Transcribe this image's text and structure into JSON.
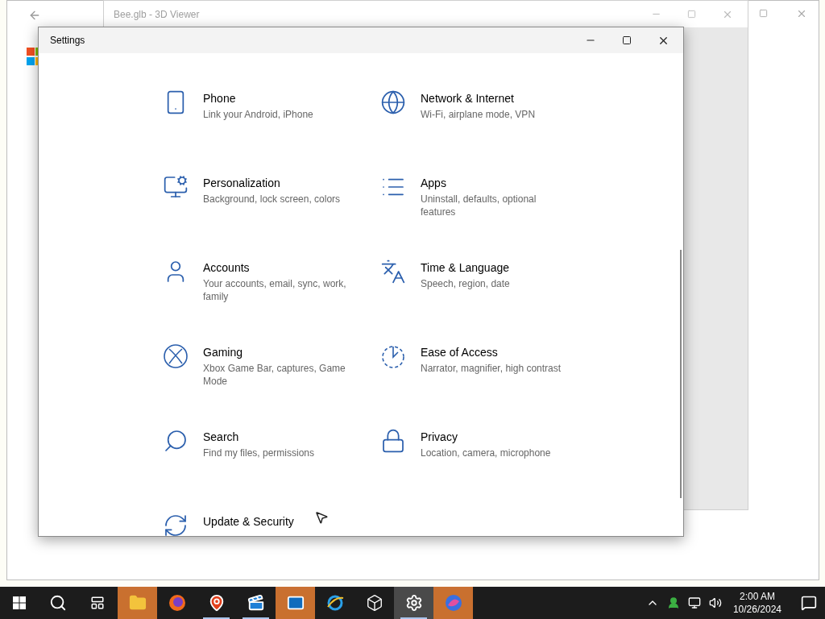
{
  "viewer_window": {
    "title": "Bee.glb - 3D Viewer"
  },
  "settings_window": {
    "title": "Settings",
    "items": [
      {
        "kind": "phone",
        "title": "Phone",
        "subtitle": "Link your Android, iPhone"
      },
      {
        "kind": "network",
        "title": "Network & Internet",
        "subtitle": "Wi-Fi, airplane mode, VPN"
      },
      {
        "kind": "personalization",
        "title": "Personalization",
        "subtitle": "Background, lock screen, colors"
      },
      {
        "kind": "apps",
        "title": "Apps",
        "subtitle": "Uninstall, defaults, optional features"
      },
      {
        "kind": "accounts",
        "title": "Accounts",
        "subtitle": "Your accounts, email, sync, work, family"
      },
      {
        "kind": "time",
        "title": "Time & Language",
        "subtitle": "Speech, region, date"
      },
      {
        "kind": "gaming",
        "title": "Gaming",
        "subtitle": "Xbox Game Bar, captures, Game Mode"
      },
      {
        "kind": "ease",
        "title": "Ease of Access",
        "subtitle": "Narrator, magnifier, high contrast"
      },
      {
        "kind": "search",
        "title": "Search",
        "subtitle": "Find my files, permissions"
      },
      {
        "kind": "privacy",
        "title": "Privacy",
        "subtitle": "Location, camera, microphone"
      },
      {
        "kind": "update",
        "title": "Update & Security"
      }
    ]
  },
  "taskbar": {
    "apps": [
      {
        "kind": "explorer",
        "flashing": true,
        "selected": false,
        "running": false
      },
      {
        "kind": "firefox",
        "flashing": false,
        "selected": false,
        "running": false
      },
      {
        "kind": "maps",
        "flashing": false,
        "selected": false,
        "running": true
      },
      {
        "kind": "movies",
        "flashing": false,
        "selected": false,
        "running": true
      },
      {
        "kind": "outlook",
        "flashing": true,
        "selected": false,
        "running": false
      },
      {
        "kind": "ie",
        "flashing": false,
        "selected": false,
        "running": false
      },
      {
        "kind": "viewer3d",
        "flashing": false,
        "selected": false,
        "running": false
      },
      {
        "kind": "settings",
        "flashing": false,
        "selected": true,
        "running": true
      },
      {
        "kind": "copilot",
        "flashing": true,
        "selected": false,
        "running": false
      }
    ],
    "clock": {
      "time": "2:00 AM",
      "date": "10/26/2024"
    }
  }
}
